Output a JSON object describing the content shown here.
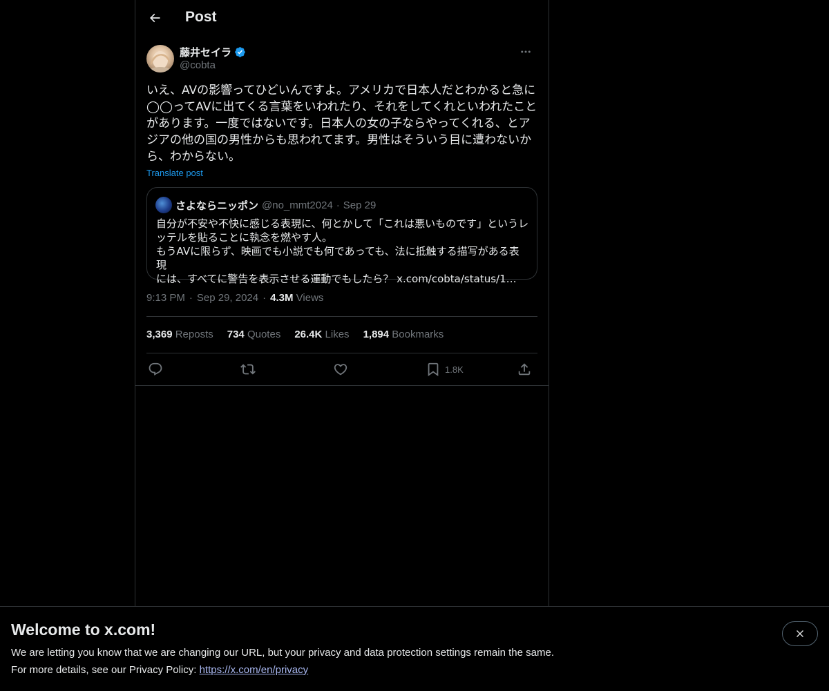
{
  "header": {
    "title": "Post",
    "back_icon": "arrow-left-icon"
  },
  "author": {
    "name": "藤井セイラ",
    "handle": "@cobta",
    "verified": true,
    "verified_color": "#1d9bf0"
  },
  "post": {
    "text": "いえ、AVの影響ってひどいんですよ。アメリカで日本人だとわかると急に\n◯◯ってAVに出てくる言葉をいわれたり、それをしてくれといわれたこと\nがあります。一度ではないです。日本人の女の子ならやってくれる、とア\nジアの他の国の男性からも思われてます。男性はそういう目に遭わないか\nら、わからない。",
    "translate_label": "Translate post"
  },
  "quote": {
    "name": "さよならニッポン",
    "handle": "@no_mmt2024",
    "separator": "·",
    "date": "Sep 29",
    "text": "自分が不安や不快に感じる表現に、何とかして「これは悪いものです」というレ\nッテルを貼ることに執念を燃やす人。\nもうAVに限らず、映画でも小説でも何であっても、法に抵触する描写がある表現\nには、すべてに警告を表示させる運動でもしたら？ x.com/cobta/status/1…"
  },
  "meta": {
    "time": "9:13 PM",
    "separator": "·",
    "date": "Sep 29, 2024",
    "views_count": "4.3M",
    "views_label": "Views"
  },
  "stats": [
    {
      "num": "3,369",
      "label": "Reposts"
    },
    {
      "num": "734",
      "label": "Quotes"
    },
    {
      "num": "26.4K",
      "label": "Likes"
    },
    {
      "num": "1,894",
      "label": "Bookmarks"
    }
  ],
  "actions": {
    "reply_icon": "reply-icon",
    "repost_icon": "repost-icon",
    "like_icon": "heart-icon",
    "bookmark_icon": "bookmark-icon",
    "bookmark_count": "1.8K",
    "share_icon": "share-icon"
  },
  "banner": {
    "title": "Welcome to x.com!",
    "line1": "We are letting you know that we are changing our URL, but your privacy and data protection settings remain the same.",
    "line2_prefix": "For more details, see our Privacy Policy: ",
    "link": "https://x.com/en/privacy",
    "close_icon": "close-icon"
  },
  "colors": {
    "background": "#000000",
    "text": "#e7e9ea",
    "muted": "#71767b",
    "accent": "#1d9bf0",
    "border": "#2f3336"
  }
}
